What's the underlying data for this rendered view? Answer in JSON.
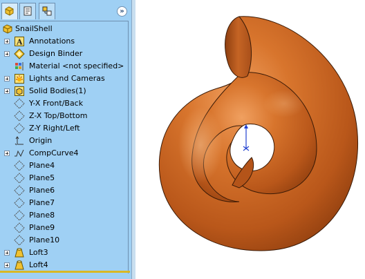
{
  "pane": {
    "tabs": [
      {
        "name": "featuremanager-tab"
      },
      {
        "name": "propertymanager-tab"
      },
      {
        "name": "configurationmanager-tab"
      }
    ],
    "collapse_glyph": "»",
    "root": {
      "label": "SnailShell",
      "icon": "part-icon"
    },
    "items": [
      {
        "label": "Annotations",
        "icon": "annotations-icon",
        "expandable": true
      },
      {
        "label": "Design Binder",
        "icon": "design-binder-icon",
        "expandable": true
      },
      {
        "label": "Material <not specified>",
        "icon": "material-icon",
        "expandable": false
      },
      {
        "label": "Lights and Cameras",
        "icon": "lights-icon",
        "expandable": true
      },
      {
        "label": "Solid Bodies(1)",
        "icon": "solid-bodies-icon",
        "expandable": true
      },
      {
        "label": "Y-X Front/Back",
        "icon": "plane-icon",
        "expandable": false
      },
      {
        "label": "Z-X Top/Bottom",
        "icon": "plane-icon",
        "expandable": false
      },
      {
        "label": "Z-Y Right/Left",
        "icon": "plane-icon",
        "expandable": false
      },
      {
        "label": "Origin",
        "icon": "origin-icon",
        "expandable": false
      },
      {
        "label": "CompCurve4",
        "icon": "curve-icon",
        "expandable": true
      },
      {
        "label": "Plane4",
        "icon": "plane-icon",
        "expandable": false
      },
      {
        "label": "Plane5",
        "icon": "plane-icon",
        "expandable": false
      },
      {
        "label": "Plane6",
        "icon": "plane-icon",
        "expandable": false
      },
      {
        "label": "Plane7",
        "icon": "plane-icon",
        "expandable": false
      },
      {
        "label": "Plane8",
        "icon": "plane-icon",
        "expandable": false
      },
      {
        "label": "Plane9",
        "icon": "plane-icon",
        "expandable": false
      },
      {
        "label": "Plane10",
        "icon": "plane-icon",
        "expandable": false
      },
      {
        "label": "Loft3",
        "icon": "loft-icon",
        "expandable": true
      },
      {
        "label": "Loft4",
        "icon": "loft-icon",
        "expandable": true
      }
    ]
  },
  "colors": {
    "pane_background": "#9fd0f4",
    "model_copper": "#c9641f",
    "triad_blue": "#1f3fd0"
  }
}
